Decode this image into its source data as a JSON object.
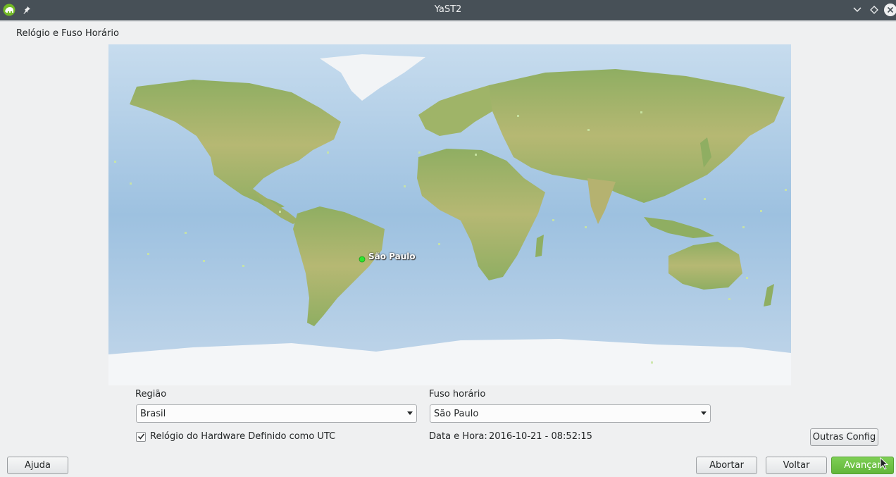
{
  "window": {
    "title": "YaST2",
    "app_icon": "yast-chameleon-icon",
    "pin_icon": "pin-icon",
    "controls": [
      "minimize-icon",
      "maximize-icon",
      "close-icon"
    ]
  },
  "page": {
    "section_title": "Relógio e Fuso Horário"
  },
  "map": {
    "selected_city": "São Paulo",
    "ocean_color": "#a9c9e4",
    "land_color": "#a7b96a",
    "ice_color": "#f4f6f8",
    "marker_color": "#2ee62e"
  },
  "region": {
    "label": "Região",
    "value": "Brasil"
  },
  "timezone": {
    "label": "Fuso horário",
    "value": "São Paulo"
  },
  "hardware_clock": {
    "label": "Relógio do Hardware Definido como UTC",
    "checked": true
  },
  "datetime": {
    "label": "Data e Hora:",
    "value": "2016-10-21 - 08:52:15"
  },
  "buttons": {
    "other_settings": "Outras Config",
    "help": "Ajuda",
    "abort": "Abortar",
    "back": "Voltar",
    "next": "Avançar"
  }
}
